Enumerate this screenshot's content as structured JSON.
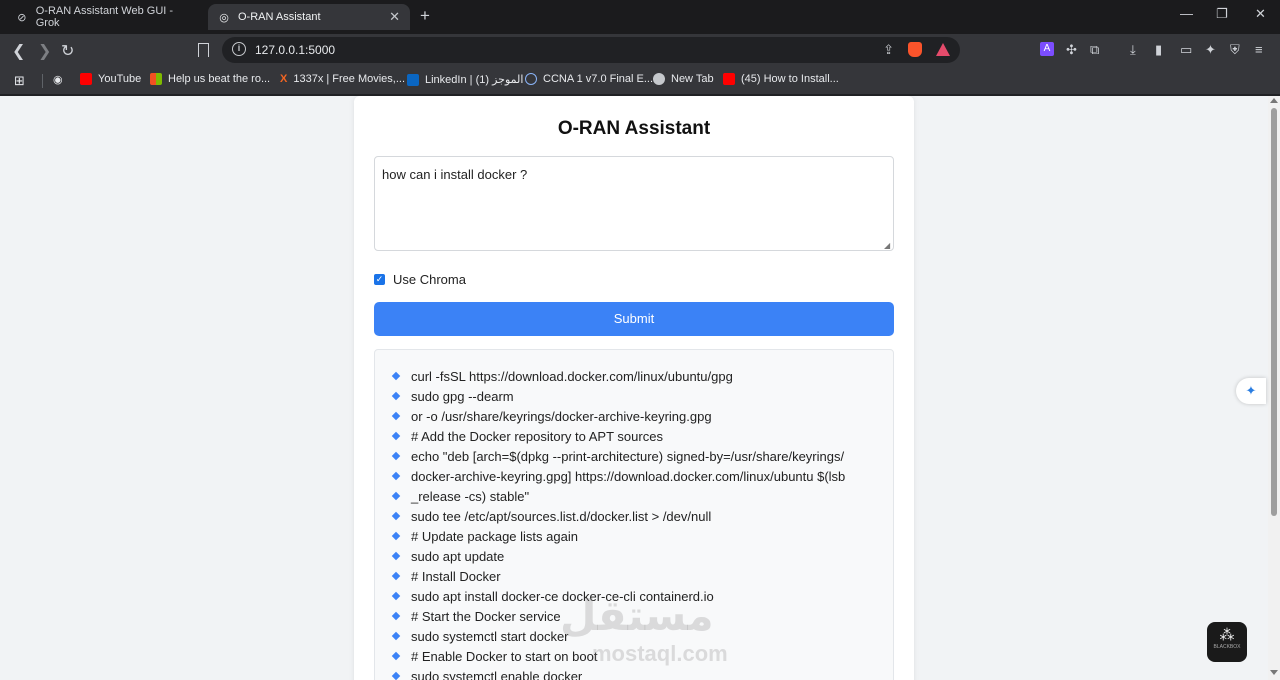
{
  "browser": {
    "tabs": [
      {
        "title": "O-RAN Assistant Web GUI - Grok",
        "active": false
      },
      {
        "title": "O-RAN Assistant",
        "active": true
      }
    ],
    "url": "127.0.0.1:5000",
    "bookmarks": [
      {
        "label": "YouTube",
        "icon": "youtube-icon"
      },
      {
        "label": "Help us beat the ro...",
        "icon": "microsoft-icon"
      },
      {
        "label": "1337x | Free Movies,...",
        "icon": "x-icon"
      },
      {
        "label": "LinkedIn | الموجز (1)",
        "icon": "linkedin-icon"
      },
      {
        "label": "CCNA 1 v7.0 Final E...",
        "icon": "link-icon"
      },
      {
        "label": "New Tab",
        "icon": "globe-icon"
      },
      {
        "label": "(45) How to Install...",
        "icon": "youtube-icon"
      }
    ]
  },
  "app": {
    "title": "O-RAN Assistant",
    "query": "how can i install docker ?",
    "use_chroma_label": "Use Chroma",
    "use_chroma_checked": true,
    "submit_label": "Submit",
    "answer_lines": [
      "curl -fsSL https://download.docker.com/linux/ubuntu/gpg",
      "sudo gpg --dearm",
      "or -o /usr/share/keyrings/docker-archive-keyring.gpg",
      "# Add the Docker repository to APT sources",
      "echo \"deb [arch=$(dpkg --print-architecture) signed-by=/usr/share/keyrings/",
      "docker-archive-keyring.gpg] https://download.docker.com/linux/ubuntu $(lsb",
      "_release -cs) stable\"",
      "sudo tee /etc/apt/sources.list.d/docker.list > /dev/null",
      "# Update package lists again",
      "sudo apt update",
      "# Install Docker",
      "sudo apt install docker-ce docker-ce-cli containerd.io",
      "# Start the Docker service",
      "sudo systemctl start docker",
      "# Enable Docker to start on boot",
      "sudo systemctl enable docker"
    ]
  },
  "overlay": {
    "watermark_arabic": "مستقل",
    "watermark_latin": "mostaql.com",
    "blackbox_label": "BLACKBOX"
  },
  "colors": {
    "accent": "#3b82f6",
    "chrome_bg": "#202124"
  }
}
